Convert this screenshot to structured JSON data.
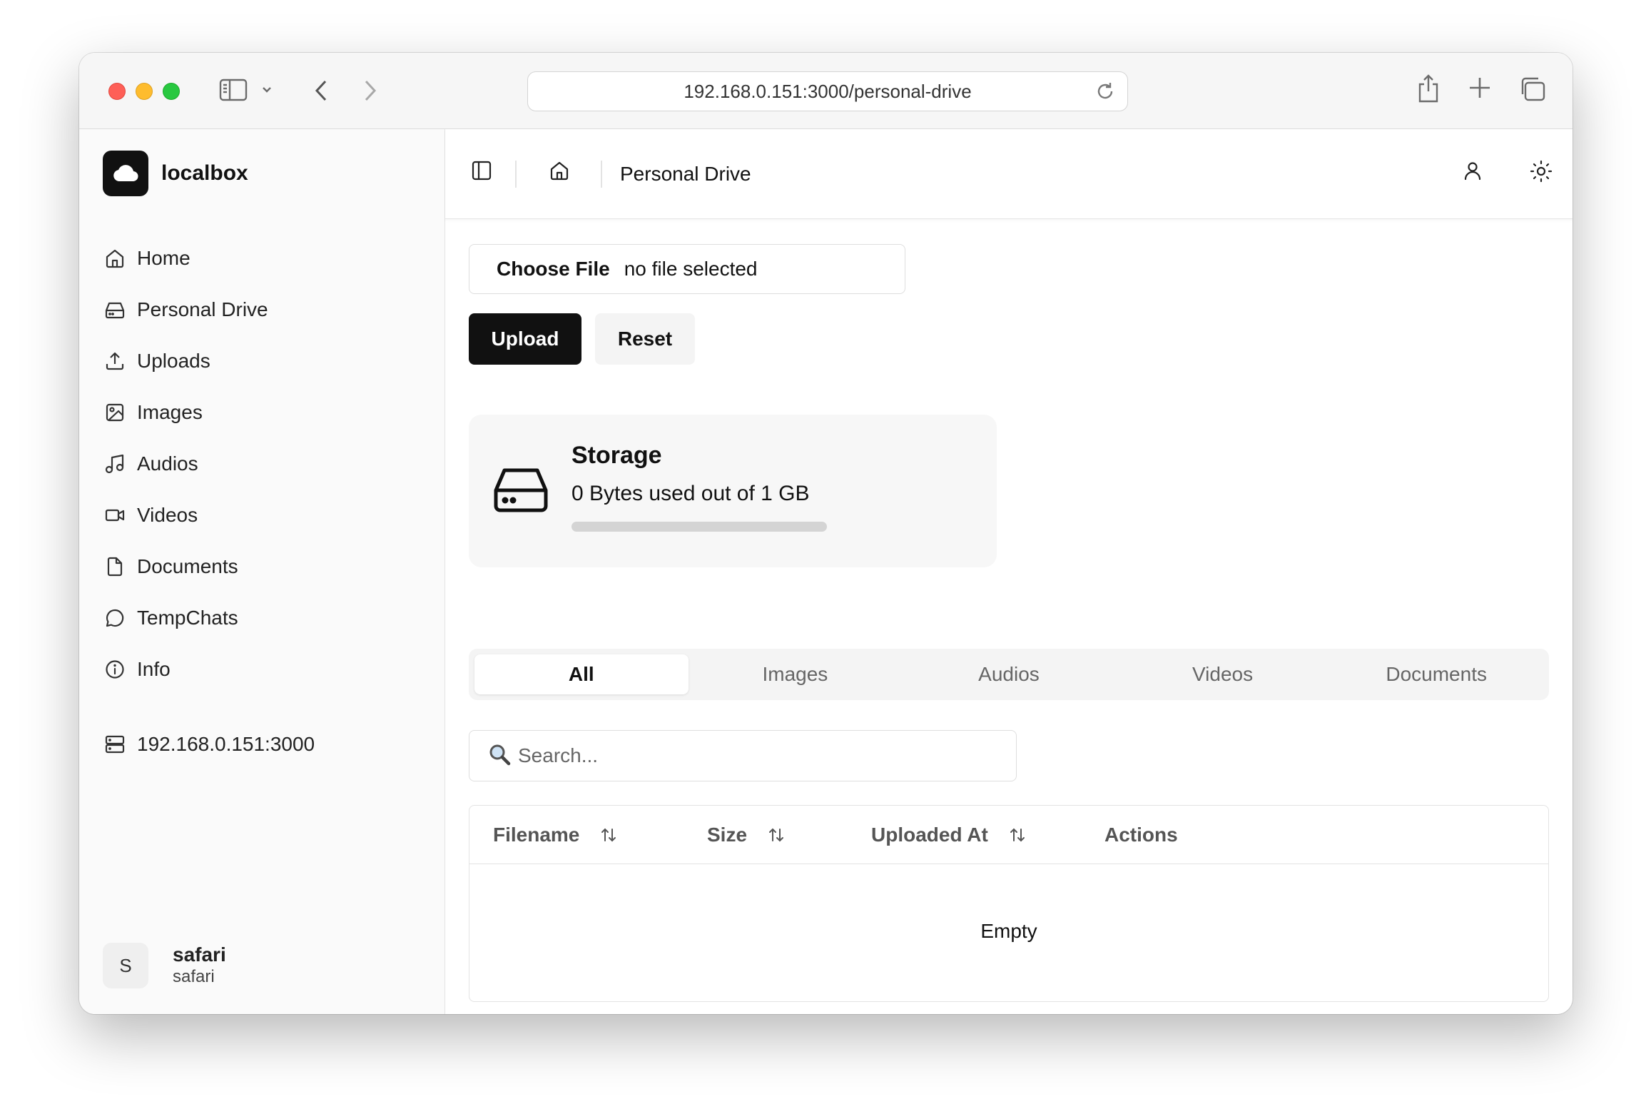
{
  "browser": {
    "url": "192.168.0.151:3000/personal-drive"
  },
  "sidebar": {
    "brand": "localbox",
    "items": [
      {
        "label": "Home",
        "icon": "home-icon"
      },
      {
        "label": "Personal Drive",
        "icon": "hard-drive-icon"
      },
      {
        "label": "Uploads",
        "icon": "upload-icon"
      },
      {
        "label": "Images",
        "icon": "image-icon"
      },
      {
        "label": "Audios",
        "icon": "music-icon"
      },
      {
        "label": "Videos",
        "icon": "video-icon"
      },
      {
        "label": "Documents",
        "icon": "file-icon"
      },
      {
        "label": "TempChats",
        "icon": "chat-icon"
      },
      {
        "label": "Info",
        "icon": "info-icon"
      }
    ],
    "server": "192.168.0.151:3000",
    "user": {
      "avatar_letter": "S",
      "name": "safari",
      "sub": "safari"
    }
  },
  "header": {
    "breadcrumb": "Personal Drive"
  },
  "upload": {
    "choose_label": "Choose File",
    "file_status": "no file selected",
    "upload_label": "Upload",
    "reset_label": "Reset"
  },
  "storage": {
    "title": "Storage",
    "usage_text": "0 Bytes used out of 1 GB",
    "used_fraction": 0
  },
  "tabs": [
    {
      "label": "All",
      "active": true
    },
    {
      "label": "Images",
      "active": false
    },
    {
      "label": "Audios",
      "active": false
    },
    {
      "label": "Videos",
      "active": false
    },
    {
      "label": "Documents",
      "active": false
    }
  ],
  "search": {
    "placeholder": "Search..."
  },
  "table": {
    "columns": [
      "Filename",
      "Size",
      "Uploaded At",
      "Actions"
    ],
    "empty_text": "Empty"
  }
}
